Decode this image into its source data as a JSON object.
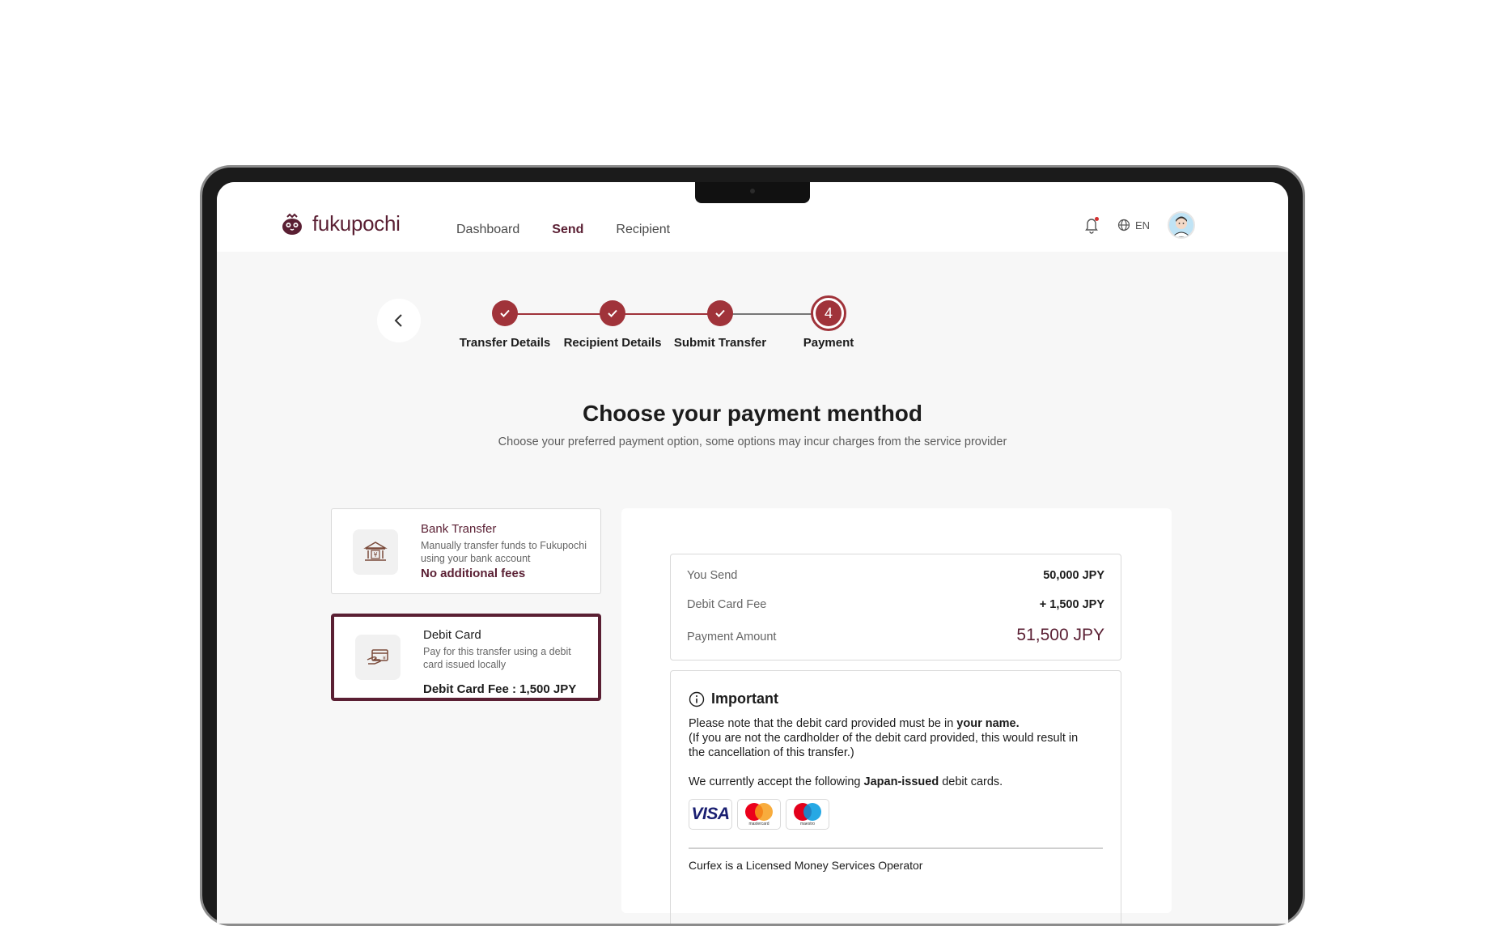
{
  "app": {
    "name": "fukupochi"
  },
  "nav": {
    "links": [
      {
        "label": "Dashboard"
      },
      {
        "label": "Send"
      },
      {
        "label": "Recipient"
      }
    ],
    "language": "EN"
  },
  "stepper": {
    "steps": [
      {
        "label": "Transfer Details",
        "status": "done"
      },
      {
        "label": "Recipient Details",
        "status": "done"
      },
      {
        "label": "Submit Transfer",
        "status": "done"
      },
      {
        "label": "Payment",
        "status": "current",
        "number": "4"
      }
    ]
  },
  "page": {
    "title": "Choose your payment menthod",
    "subtitle": "Choose your preferred payment option, some options may incur charges from the service provider"
  },
  "options": [
    {
      "title": "Bank Transfer",
      "description": "Manually transfer funds to Fukupochi using your bank account",
      "note": "No additional fees",
      "selected": false,
      "icon": "bank-icon"
    },
    {
      "title": "Debit Card",
      "description": "Pay for this transfer using a debit card issued locally",
      "note": "Debit Card Fee : 1,500 JPY",
      "selected": true,
      "icon": "card-payment-icon"
    }
  ],
  "summary": {
    "rows": [
      {
        "label": "You Send",
        "value": "50,000 JPY"
      },
      {
        "label": "Debit Card Fee",
        "value": "+ 1,500 JPY"
      },
      {
        "label": "Payment Amount",
        "value": "51,500 JPY"
      }
    ]
  },
  "important": {
    "title": "Important",
    "line1_prefix": "Please note that the debit card provided must be in ",
    "line1_bold": "your name.",
    "line2": "(If you are not the cardholder of the debit card provided, this would result in the cancellation of this transfer.)",
    "line3_prefix": "We currently accept the following ",
    "line3_bold": "Japan-issued",
    "line3_suffix": " debit cards.",
    "cards": [
      {
        "name": "VISA"
      },
      {
        "name": "mastercard"
      },
      {
        "name": "maestro"
      }
    ],
    "footer": "Curfex is a Licensed Money Services Operator"
  },
  "colors": {
    "brand": "#5a1f33",
    "step_active": "#a0333a",
    "page_bg": "#f7f7f7"
  }
}
